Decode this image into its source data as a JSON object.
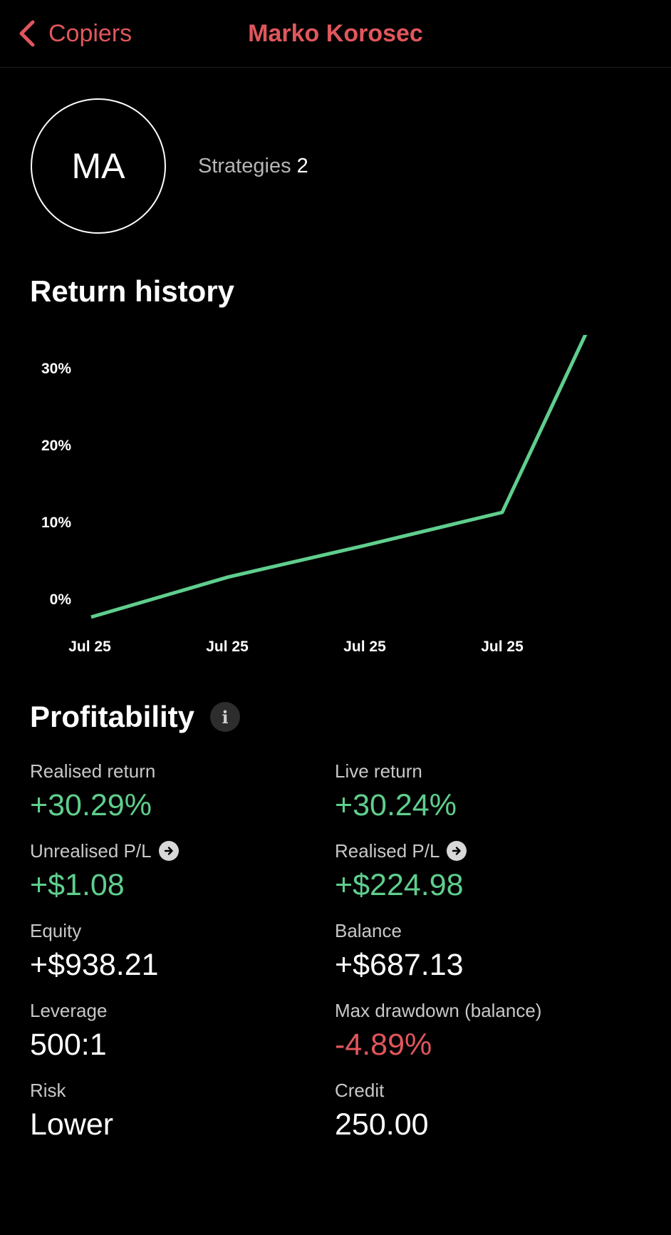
{
  "nav": {
    "back_label": "Copiers",
    "title": "Marko Korosec"
  },
  "profile": {
    "initials": "MA",
    "strategies_label": "Strategies",
    "strategies_count": "2"
  },
  "return_history": {
    "title": "Return history"
  },
  "chart_data": {
    "type": "line",
    "title": "Return history",
    "x": [
      "Jul 25",
      "Jul 25",
      "Jul 25",
      "Jul 25",
      "Jul 25"
    ],
    "x_tick_labels": [
      "Jul 25",
      "Jul 25",
      "Jul 25",
      "Jul 25"
    ],
    "y_tick_labels": [
      "30%",
      "20%",
      "10%",
      "0%"
    ],
    "y_ticks": [
      30,
      20,
      10,
      0
    ],
    "series": [
      {
        "values": [
          -2.4,
          2.8,
          6.9,
          11.2,
          35.5
        ]
      }
    ],
    "ylim": [
      0,
      30
    ],
    "grid": false,
    "line_color": "#5fce8d"
  },
  "profitability": {
    "title": "Profitability",
    "info_icon": "info-icon",
    "metrics": [
      {
        "label": "Realised return",
        "value": "+30.29%",
        "color": "green"
      },
      {
        "label": "Live return",
        "value": "+30.24%",
        "color": "green"
      },
      {
        "label": "Unrealised P/L",
        "value": "+$1.08",
        "color": "green",
        "icon": "arrow-right-icon"
      },
      {
        "label": "Realised P/L",
        "value": "+$224.98",
        "color": "green",
        "icon": "arrow-right-icon"
      },
      {
        "label": "Equity",
        "value": "+$938.21",
        "color": "white"
      },
      {
        "label": "Balance",
        "value": "+$687.13",
        "color": "white"
      },
      {
        "label": "Leverage",
        "value": "500:1",
        "color": "white"
      },
      {
        "label": "Max drawdown (balance)",
        "value": "-4.89%",
        "color": "red"
      },
      {
        "label": "Risk",
        "value": "Lower",
        "color": "white"
      },
      {
        "label": "Credit",
        "value": "250.00",
        "color": "white"
      }
    ]
  },
  "colors": {
    "accent": "#e0565c",
    "positive": "#5fce8d",
    "negative": "#e0565c",
    "background": "#000000"
  }
}
